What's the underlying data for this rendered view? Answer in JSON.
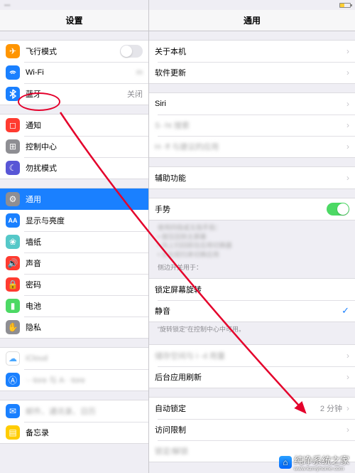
{
  "statusbar": {
    "carrier_blurred": "···",
    "battery_blurred": true
  },
  "left": {
    "title": "设置",
    "groups": [
      {
        "rows": [
          {
            "id": "airplane",
            "icon": "airplane-icon",
            "color": "#ff9500",
            "label": "飞行模式",
            "switch": false
          },
          {
            "id": "wifi",
            "icon": "wifi-icon",
            "color": "#1a80ff",
            "label": "Wi-Fi",
            "value_blurred": "m",
            "chevron": false
          },
          {
            "id": "bluetooth",
            "icon": "bluetooth-icon",
            "color": "#1a80ff",
            "label": "蓝牙",
            "value": "关闭"
          }
        ]
      },
      {
        "rows": [
          {
            "id": "notifications",
            "icon": "bell-icon",
            "color": "#ff3b30",
            "label": "通知"
          },
          {
            "id": "control-center",
            "icon": "toggles-icon",
            "color": "#8e8e93",
            "label": "控制中心"
          },
          {
            "id": "dnd",
            "icon": "moon-icon",
            "color": "#5856d6",
            "label": "勿扰模式"
          }
        ]
      },
      {
        "rows": [
          {
            "id": "general",
            "icon": "gear-icon",
            "color": "#8e8e93",
            "label": "通用",
            "selected": true
          },
          {
            "id": "display",
            "icon": "display-icon",
            "color": "#1a80ff",
            "label": "显示与亮度"
          },
          {
            "id": "wallpaper",
            "icon": "flower-icon",
            "color": "#55c8c8",
            "label": "墙纸"
          },
          {
            "id": "sound",
            "icon": "speaker-icon",
            "color": "#ff3b30",
            "label": "声音"
          },
          {
            "id": "passcode",
            "icon": "lock-icon",
            "color": "#ff3b30",
            "label": "密码"
          },
          {
            "id": "battery",
            "icon": "battery-icon",
            "color": "#4cd964",
            "label": "电池"
          },
          {
            "id": "privacy",
            "icon": "hand-icon",
            "color": "#8e8e93",
            "label": "隐私"
          }
        ]
      },
      {
        "rows": [
          {
            "id": "icloud",
            "icon": "cloud-icon",
            "color": "#ffffff",
            "label_blurred": "iCloud"
          },
          {
            "id": "appstore",
            "icon": "appstore-icon",
            "color": "#1a80ff",
            "label_blurred": "···tore 与 A· ·tore"
          }
        ]
      },
      {
        "rows": [
          {
            "id": "mail",
            "icon": "mail-icon",
            "color": "#1a80ff",
            "label_blurred": "邮件、通讯录、日历"
          },
          {
            "id": "notes",
            "icon": "note-icon",
            "color": "#ffcc00",
            "label": "备忘录"
          }
        ]
      }
    ]
  },
  "right": {
    "title": "通用",
    "groups": [
      {
        "rows": [
          {
            "id": "about",
            "label": "关于本机",
            "chevron": true
          },
          {
            "id": "software-update",
            "label": "软件更新",
            "chevron": true
          }
        ]
      },
      {
        "rows": [
          {
            "id": "siri",
            "label": "Siri",
            "chevron": true
          },
          {
            "id": "spotlight",
            "label_blurred": "S··ht 搜索",
            "chevron": true
          },
          {
            "id": "handoff",
            "label_blurred": "H··ff 与建议的应用",
            "chevron": true
          }
        ]
      },
      {
        "rows": [
          {
            "id": "accessibility",
            "label": "辅助功能",
            "chevron": true
          }
        ]
      },
      {
        "rows": [
          {
            "id": "gestures",
            "label": "手势",
            "switch_on": true
          }
        ],
        "footnote_lines": [
          "使用四指或五指手指：",
          "• 按压回到主屏幕",
          "• 向上扫回前往应用切换器",
          "• 左右轻扫来切换应用"
        ],
        "footer_header": "侧边开关用于：",
        "footer_rows": [
          {
            "id": "lock-rotation",
            "label": "锁定屏幕旋转"
          },
          {
            "id": "mute",
            "label": "静音",
            "check": true
          }
        ],
        "footer_note": "“旋转锁定”在控制中心中可用。"
      },
      {
        "rows": [
          {
            "id": "storage",
            "label_blurred": "储存空间与 i··d 用量",
            "chevron": true
          },
          {
            "id": "background-refresh",
            "label": "后台应用刷新",
            "chevron": true
          }
        ]
      },
      {
        "rows": [
          {
            "id": "autolock",
            "label": "自动锁定",
            "value": "2 分钟",
            "chevron": true
          },
          {
            "id": "restrictions",
            "label": "访问限制",
            "chevron": true
          },
          {
            "id": "lockunlock",
            "label_blurred": "锁定/解锁"
          }
        ]
      }
    ]
  },
  "watermark": {
    "title": "纯净系统之家",
    "sub": "www.kzmyhome.com"
  }
}
